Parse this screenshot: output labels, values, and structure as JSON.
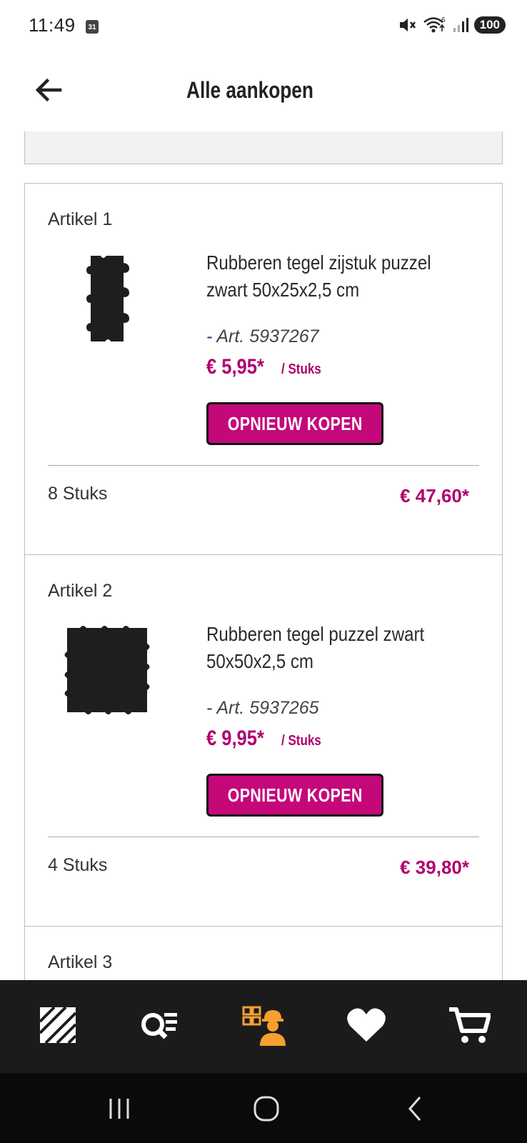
{
  "status_bar": {
    "time": "11:49",
    "calendar_day": "31",
    "battery": "100",
    "wifi_badge": "6"
  },
  "header": {
    "title": "Alle aankopen"
  },
  "items": [
    {
      "label": "Artikel 1",
      "name_line1": "Rubberen tegel zijstuk puzzel",
      "name_line2": "zwart 50x25x2,5 cm",
      "art_dash": "-",
      "art_nr": "Art. 5937267",
      "price": "€ 5,95*",
      "unit": "/ Stuks",
      "button": "OPNIEUW KOPEN",
      "quantity": "8 Stuks",
      "total": "€ 47,60*"
    },
    {
      "label": "Artikel 2",
      "name_line1": "Rubberen tegel puzzel zwart",
      "name_line2": "50x50x2,5 cm",
      "art_dash": "-",
      "art_nr": "Art. 5937265",
      "price": "€ 9,95*",
      "unit": "/ Stuks",
      "button": "OPNIEUW KOPEN",
      "quantity": "4 Stuks",
      "total": "€ 39,80*"
    },
    {
      "label": "Artikel 3"
    }
  ],
  "bottom_nav": [
    "home-logo-icon",
    "search-list-icon",
    "projects-worker-icon",
    "heart-icon",
    "cart-icon"
  ],
  "colors": {
    "accent": "#c4087a",
    "price": "#b0006e",
    "active_nav": "#f5a030",
    "nav_bg": "#1b1b1b"
  }
}
